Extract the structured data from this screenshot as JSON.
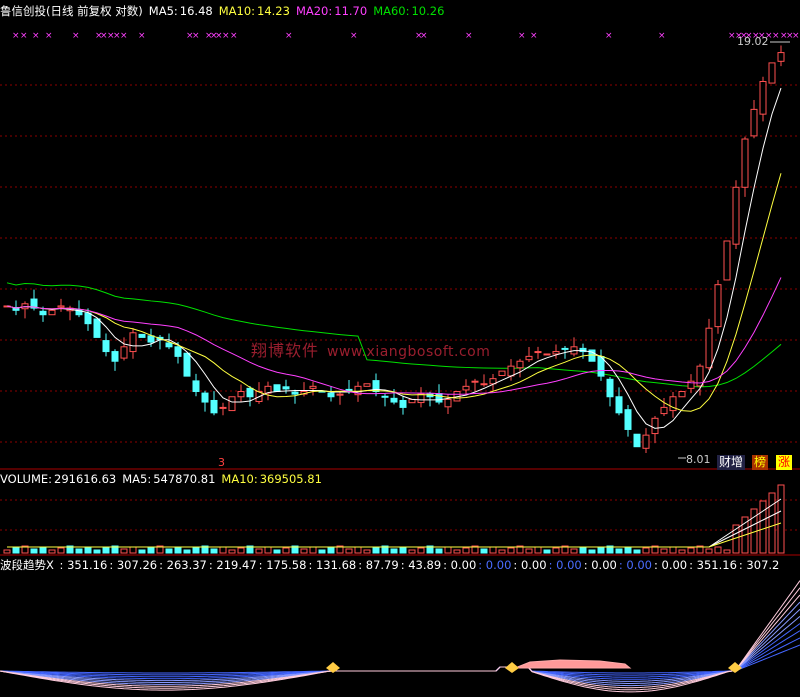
{
  "header": {
    "title": "鲁信创投(日线 前复权 对数)",
    "ma5_label": "MA5:",
    "ma5_value": "16.48",
    "ma10_label": "MA10:",
    "ma10_value": "14.23",
    "ma20_label": "MA20:",
    "ma20_value": "11.70",
    "ma60_label": "MA60:",
    "ma60_value": "10.26"
  },
  "volume_header": {
    "label": "VOLUME:",
    "value": "291616.63",
    "ma5_label": "MA5:",
    "ma5_value": "547870.81",
    "ma10_label": "MA10:",
    "ma10_value": "369505.81"
  },
  "indicator_header": {
    "label": "波段趋势X",
    "values": [
      "351.16",
      "307.26",
      "263.37",
      "219.47",
      "175.58",
      "131.68",
      "87.79",
      "43.89",
      "0.00",
      "0.00",
      "0.00",
      "0.00",
      "0.00",
      "0.00",
      "0.00",
      "351.16",
      "307.2"
    ]
  },
  "annotations": {
    "high_price": "19.02",
    "low_price": "8.01",
    "watermark_cn": "翔博软件",
    "watermark_url": "www.xiangbosoft.com",
    "tag_1": "财增",
    "tag_2": "榜",
    "tag_3": "涨",
    "marker_3": "3"
  },
  "colors": {
    "up": "#ff5050",
    "down": "#54ffff",
    "ma5": "#ffffff",
    "ma10": "#ffff40",
    "ma20": "#ff40ff",
    "ma60": "#00e000",
    "grid": "#8b0000",
    "marker": "#ff40ff"
  },
  "chart_data": {
    "type": "candlestick",
    "price_scale": "log",
    "price_range": [
      8.01,
      19.02
    ],
    "series": [
      {
        "name": "MA5",
        "last": 16.48
      },
      {
        "name": "MA10",
        "last": 14.23
      },
      {
        "name": "MA20",
        "last": 11.7
      },
      {
        "name": "MA60",
        "last": 10.26
      }
    ],
    "closes": [
      10.9,
      10.8,
      10.95,
      10.85,
      10.7,
      10.8,
      10.9,
      10.85,
      10.7,
      10.5,
      10.2,
      9.9,
      9.7,
      10.0,
      10.3,
      10.2,
      10.1,
      10.15,
      10.0,
      9.8,
      9.4,
      9.1,
      8.9,
      8.7,
      8.8,
      9.0,
      9.1,
      9.0,
      9.1,
      9.2,
      9.1,
      9.15,
      9.05,
      9.1,
      9.2,
      9.1,
      9.0,
      9.05,
      9.1,
      9.2,
      9.25,
      9.1,
      9.0,
      8.9,
      8.8,
      8.95,
      9.05,
      9.0,
      8.9,
      8.95,
      9.1,
      9.2,
      9.3,
      9.25,
      9.35,
      9.5,
      9.6,
      9.7,
      9.8,
      9.9,
      9.85,
      9.9,
      9.95,
      10.0,
      9.9,
      9.7,
      9.4,
      9.0,
      8.7,
      8.4,
      8.1,
      8.3,
      8.6,
      8.8,
      9.0,
      9.1,
      9.3,
      9.6,
      10.4,
      11.4,
      12.5,
      14.0,
      15.5,
      16.5,
      17.5,
      18.2,
      18.6
    ],
    "volume_values": {
      "last": 291616.63,
      "ma5": 547870.81,
      "ma10": 369505.81
    }
  }
}
